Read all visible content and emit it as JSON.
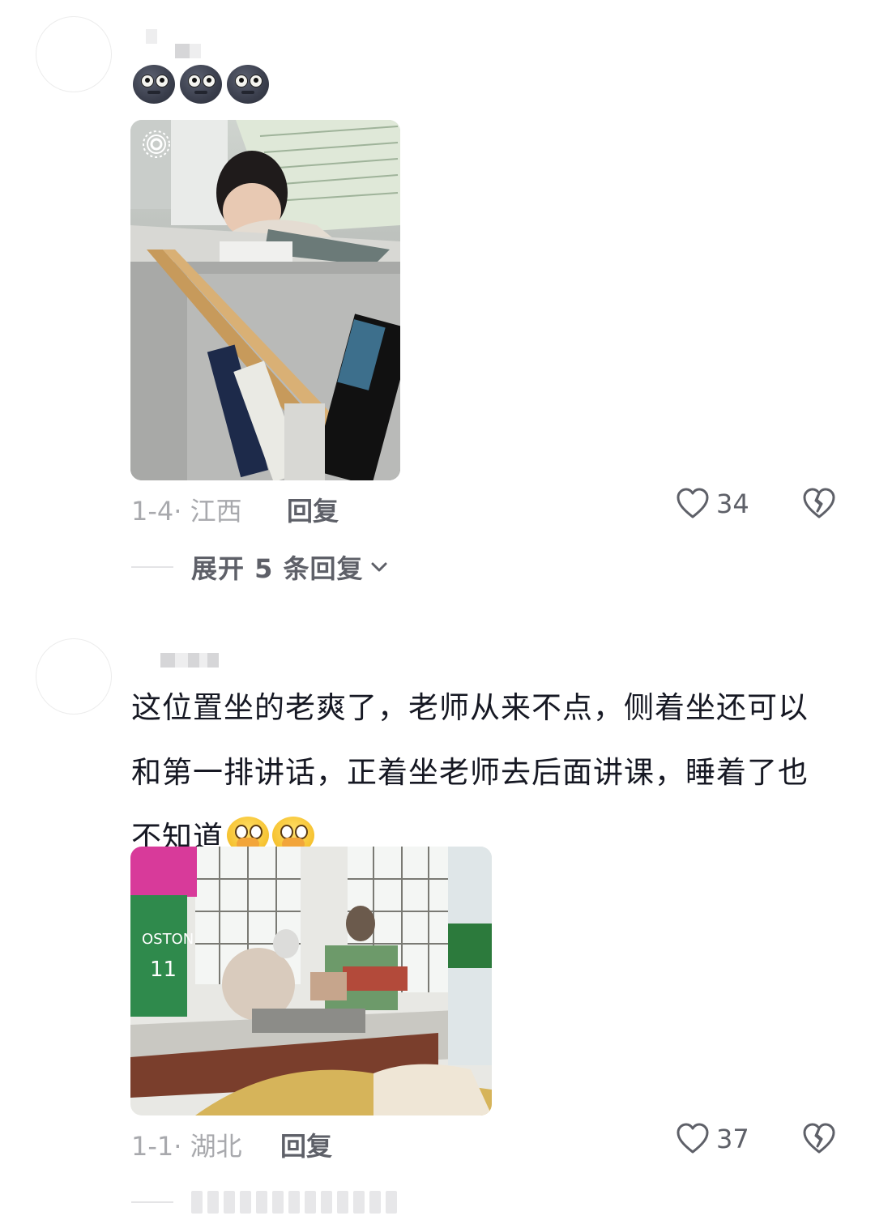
{
  "comments": [
    {
      "date": "1-4",
      "location": "江西",
      "reply_label": "回复",
      "like_count": "34",
      "emojis": [
        "moon-face-icon",
        "moon-face-icon",
        "moon-face-icon"
      ],
      "expand_label": "展开 5 条回复"
    },
    {
      "text": "这位置坐的老爽了，老师从来不点，侧着坐还可以和第一排讲话，正着坐老师去后面讲课，睡着了也不知道",
      "text_lines": [
        "这位置坐的老爽了，老师从来不点，侧着坐还可以",
        "和第一排讲话，正着坐老师去后面讲课，睡着了也",
        "不知道"
      ],
      "emojis": [
        "holding-back-tears-icon",
        "holding-back-tears-icon"
      ],
      "date": "1-1",
      "location": "湖北",
      "reply_label": "回复",
      "like_count": "37"
    }
  ],
  "colors": {
    "meta_gray": "#a8a9ad",
    "action_gray": "#5e6068",
    "text": "#161823"
  }
}
